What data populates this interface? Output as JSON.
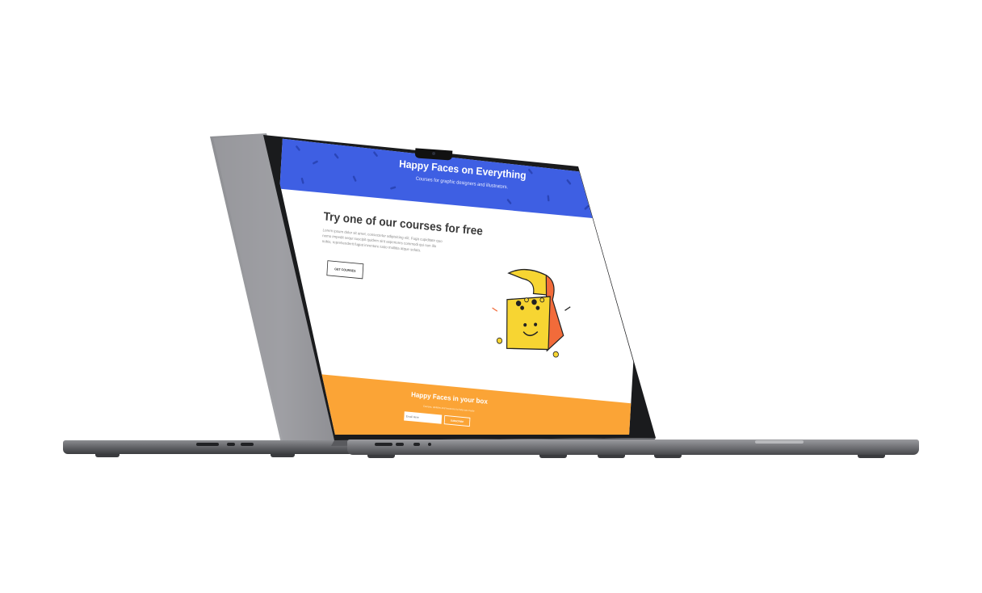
{
  "site": {
    "hero": {
      "title": "Happy Faces on Everything",
      "subtitle": "Courses for graphic designers and illustrators."
    },
    "promo": {
      "title": "Try one of our courses for free",
      "text": "Lorem ipsum dolor sit amet, consectetur adipisicing elit. Fuga cupiditate quo nemo impedit sequi suscipit quidem sint asperiores commodi qui non illo nobis, reprehenderit fugiat inventore iusto mollitia atque soluta.",
      "button_label": "GET COURSES"
    },
    "newsletter": {
      "title": "Happy Faces in your box",
      "subtitle": "Courses, updates and resources to help you create",
      "email_placeholder": "Email Here",
      "subscribe_label": "SUBSCRIBE"
    }
  },
  "colors": {
    "hero_blue": "#3e5fe3",
    "band_orange": "#fba436",
    "laptop_gray": "#6d6e72",
    "chest_yellow": "#f7d532",
    "chest_orange": "#f26b3a"
  },
  "icons": {
    "illustration": "treasure-chest-illustration",
    "camera": "camera-notch"
  }
}
